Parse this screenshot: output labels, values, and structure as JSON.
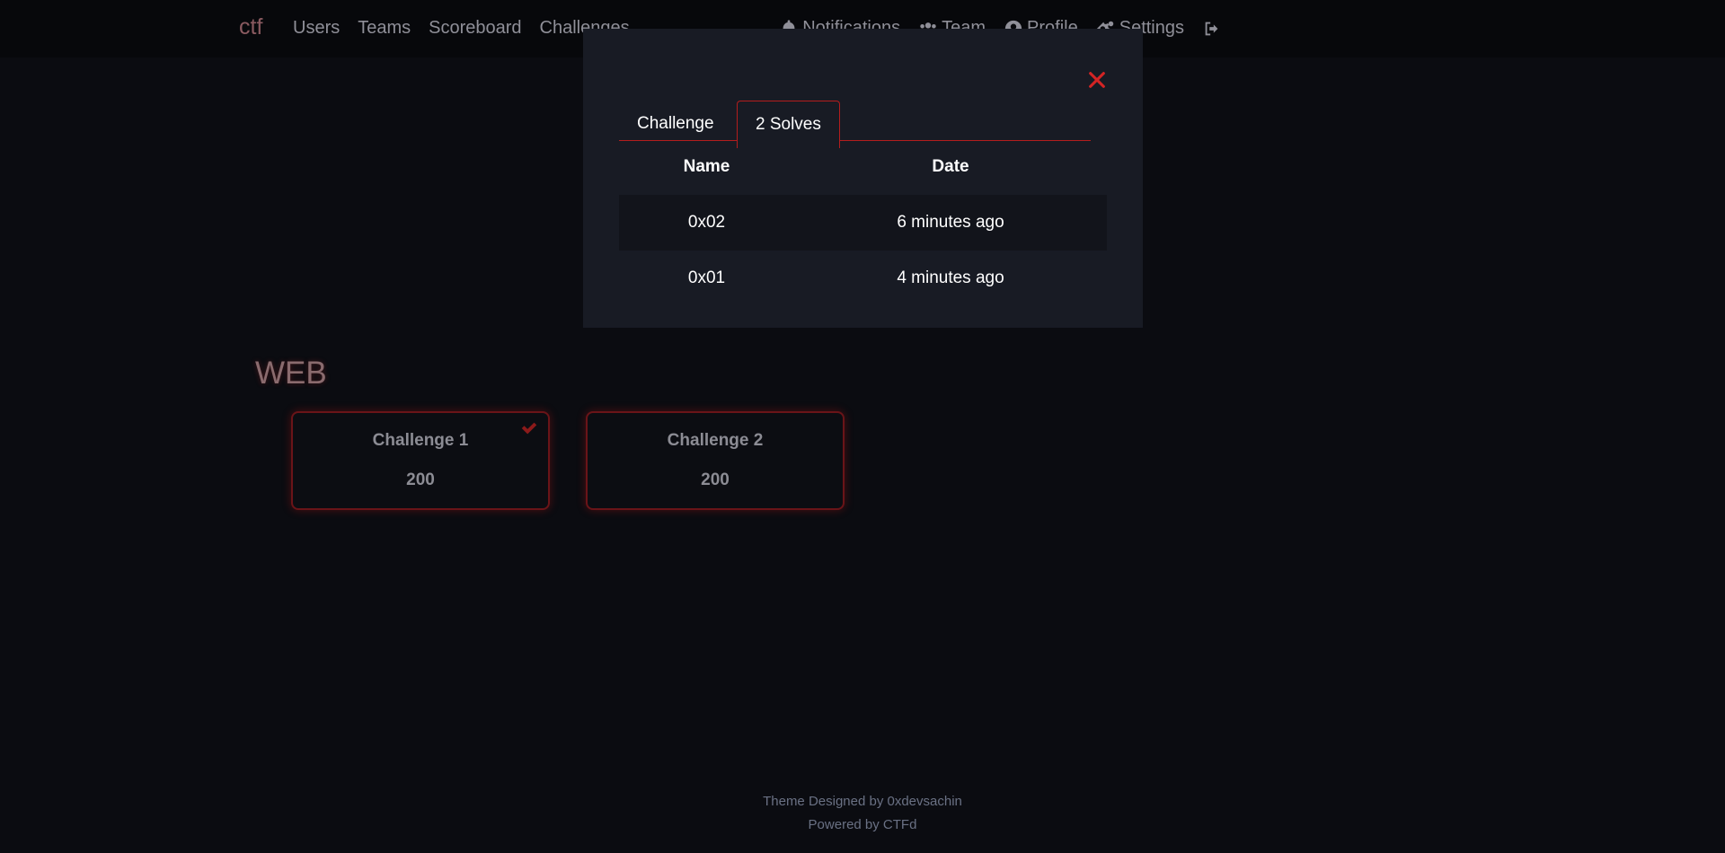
{
  "navbar": {
    "brand": "ctf",
    "left_links": [
      "Users",
      "Teams",
      "Scoreboard",
      "Challenges"
    ],
    "right_links": [
      {
        "label": "Notifications",
        "icon": "bell-icon"
      },
      {
        "label": "Team",
        "icon": "users-icon"
      },
      {
        "label": "Profile",
        "icon": "user-circle-icon"
      },
      {
        "label": "Settings",
        "icon": "gears-icon"
      },
      {
        "label": "",
        "icon": "logout-icon"
      }
    ]
  },
  "category": {
    "title": "WEB",
    "cards": [
      {
        "name": "Challenge 1",
        "value": "200",
        "solved": true
      },
      {
        "name": "Challenge 2",
        "value": "200",
        "solved": false
      }
    ]
  },
  "modal": {
    "tabs": [
      "Challenge",
      "2 Solves"
    ],
    "active_tab": "2 Solves",
    "table": {
      "headers": [
        "Name",
        "Date"
      ],
      "rows": [
        {
          "name": "0x02",
          "date": "6 minutes ago"
        },
        {
          "name": "0x01",
          "date": "4 minutes ago"
        }
      ]
    }
  },
  "footer": {
    "line1": "Theme Designed by 0xdevsachin",
    "line2": "Powered by CTFd"
  },
  "colors": {
    "accent": "#b31d1d",
    "background": "#0b0c11",
    "modal_bg": "#181b24"
  }
}
